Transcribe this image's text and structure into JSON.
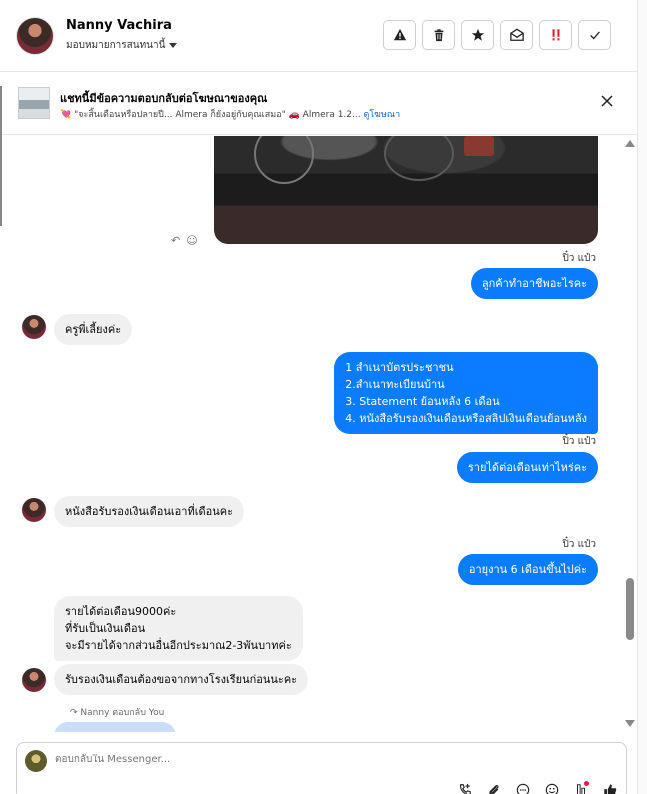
{
  "header": {
    "contact_name": "Nanny Vachira",
    "assign_label": "มอบหมายการสนทนานี้",
    "actions": [
      {
        "name": "spam-button",
        "icon": "warning-icon"
      },
      {
        "name": "delete-button",
        "icon": "trash-icon"
      },
      {
        "name": "star-button",
        "icon": "star-icon"
      },
      {
        "name": "mark-unread-button",
        "icon": "envelope-icon"
      },
      {
        "name": "follow-up-button",
        "icon": "double-exclaim-icon"
      },
      {
        "name": "done-button",
        "icon": "check-icon"
      }
    ]
  },
  "ad": {
    "title": "แชทนี้มีข้อความตอบกลับต่อโฆษณาของคุณ",
    "subtitle": "💘 \"จะสิ้นเดือนหรือปลายปี... Almera ก็ยังอยู่กับคุณเสมอ\" 🚗 Almera 1.2...",
    "link": "ดูโฆษณา"
  },
  "messages": {
    "sender_tag": "ปิ๋ว แป๋ว",
    "out_1": "ลูกค้าทำอาชีพอะไรคะ",
    "in_1": "ครูพี่เลี้ยงค่ะ",
    "out_2_lines": "1 สำเนาบัตรประชาชน\n2.สำเนาทะเบียนบ้าน\n 3. Statement ย้อนหลัง 6 เดือน\n4. หนังสือรับรองเงินเดือนหรือสลิปเงินเดือนย้อนหลัง",
    "out_3": "รายได้ต่อเดือนเท่าไหร่คะ",
    "in_2": "หนังสือรับรองเงินเดือนเอาที่เดือนคะ",
    "out_4": "อายุงาน 6 เดือนขึ้นไปค่ะ",
    "in_3_lines": "รายได้ต่อเดือน9000ค่ะ\nที่รับเป็นเงินเดือน\nจะมีรายได้จากส่วนอื่นอีกประมาณ2-3พันบาทค่ะ",
    "in_4": "รับรองเงินเดือนต้องขอจากทางโรงเรียนก่อนนะคะ",
    "reply_hint": "Nanny ตอบกลับ You"
  },
  "composer": {
    "placeholder": "ตอบกลับใน Messenger..."
  },
  "colors": {
    "outgoing_bubble": "#0a7cff",
    "incoming_bubble": "#f0f0f0",
    "link": "#0a66d8"
  }
}
